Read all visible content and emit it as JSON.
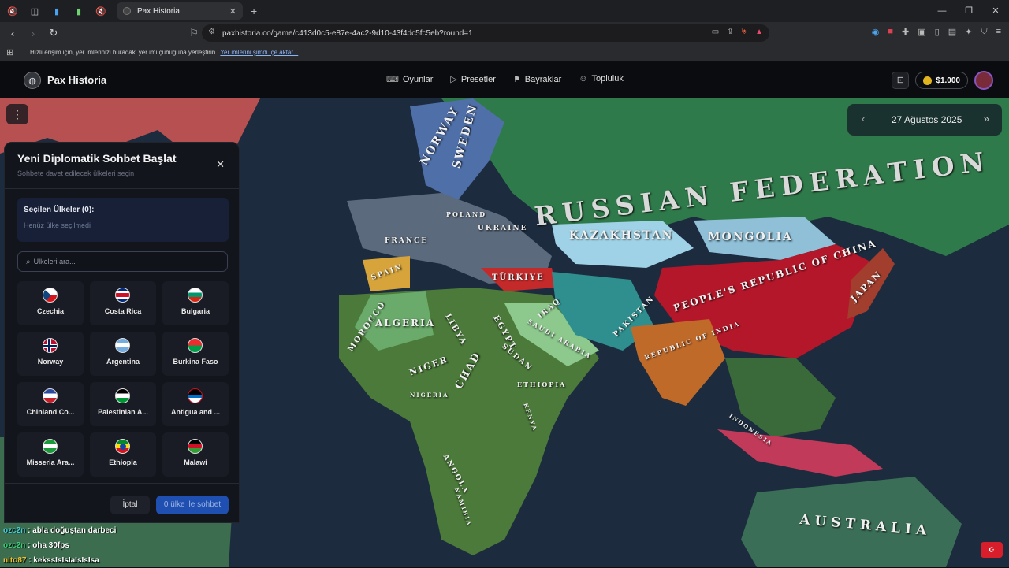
{
  "browser": {
    "tab_title": "Pax Historia",
    "url": "paxhistoria.co/game/c413d0c5-e87e-4ac2-9d10-43f4dc5fc5eb?round=1",
    "bookmarks_hint": "Hızlı erişim için, yer imlerinizi buradaki yer imi çubuğuna yerleştirin.",
    "bookmarks_link": "Yer imlerini şimdi içe aktar..."
  },
  "app": {
    "brand": "Pax Historia",
    "nav": [
      "Oyunlar",
      "Presetler",
      "Bayraklar",
      "Topluluk"
    ],
    "coins": "$1.000"
  },
  "map": {
    "date": "27 Ağustos 2025",
    "labels": [
      "RUSSIAN FEDERATION",
      "KAZAKHSTAN",
      "MONGOLIA",
      "PEOPLE'S REPUBLIC OF CHINA",
      "JAPAN",
      "TÜRKIYE",
      "ALGERIA",
      "MOROCCO",
      "LIBYA",
      "EGYPT",
      "CHAD",
      "NIGER",
      "SUDAN",
      "ETHIOPIA",
      "FRANCE",
      "SPAIN",
      "SWEDEN",
      "NORWAY",
      "UKRAINE",
      "POLAND",
      "IRAQ",
      "REPUBLIC OF INDIA",
      "PAKISTAN",
      "AUSTRALIA",
      "ANGOLA",
      "NIGERIA",
      "SAUDI ARABIA",
      "INDONESIA",
      "KENYA",
      "NAMIBIA"
    ]
  },
  "panel": {
    "title": "Yeni Diplomatik Sohbet Başlat",
    "subtitle": "Sohbete davet edilecek ülkeleri seçin",
    "selected_label": "Seçilen Ülkeler (0):",
    "selected_empty": "Henüz ülke seçilmedi",
    "search_placeholder": "Ülkeleri ara...",
    "countries": [
      "Czechia",
      "Costa Rica",
      "Bulgaria",
      "Norway",
      "Argentina",
      "Burkina Faso",
      "Chinland Co...",
      "Palestinian A...",
      "Antigua and ...",
      "Misseria Ara...",
      "Ethiopia",
      "Malawi"
    ],
    "cancel": "İptal",
    "start": "0 ülke ile sohbet"
  },
  "chat": [
    {
      "user": "ozc2n",
      "msg": ": abla doğuştan darbeci"
    },
    {
      "user": "ozc2n",
      "msg": ": oha 30fps"
    },
    {
      "user": "nito87",
      "msg": ": kekssIsIsIaIsIsIsa"
    }
  ]
}
